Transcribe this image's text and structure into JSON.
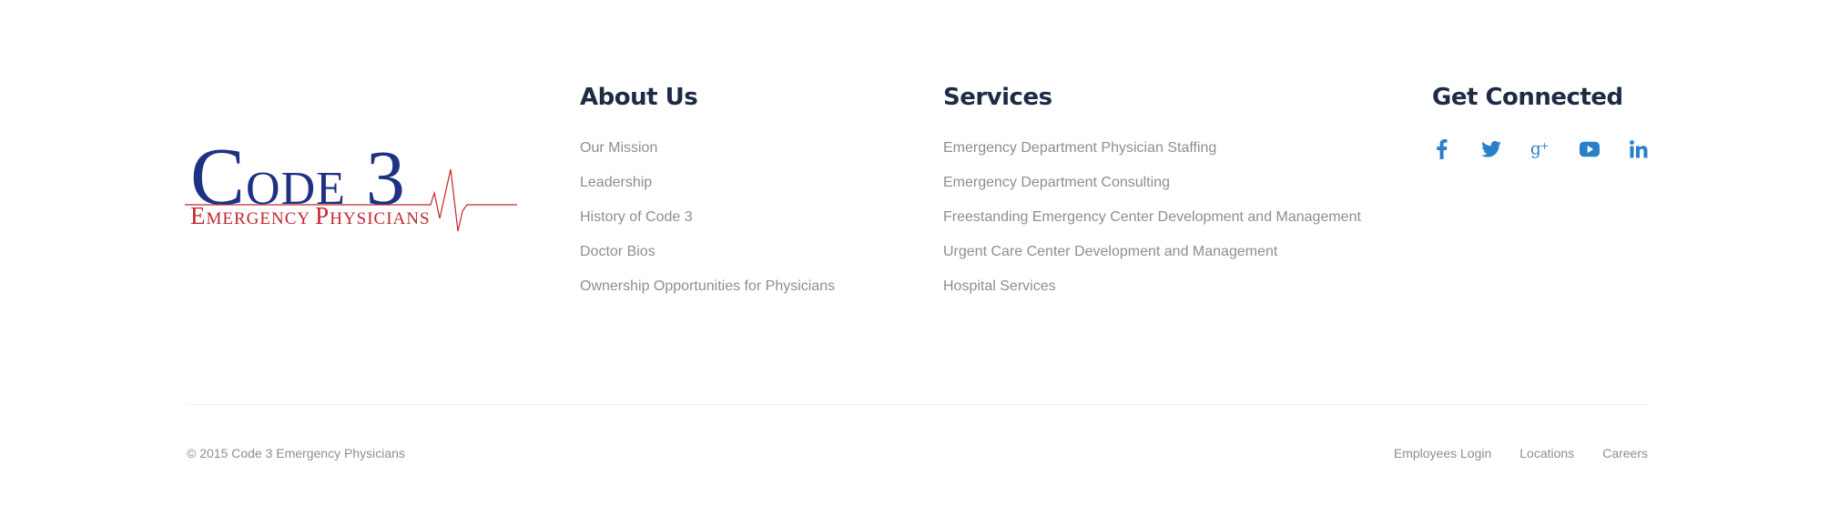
{
  "logo": {
    "text_main": "Code 3",
    "text_sub": "Emergency Physicians",
    "colors": {
      "main": "#1d3283",
      "sub": "#c1272d"
    }
  },
  "about": {
    "heading": "About Us",
    "links": [
      "Our Mission",
      "Leadership",
      "History of Code 3",
      "Doctor Bios",
      "Ownership Opportunities for Physicians"
    ]
  },
  "services": {
    "heading": "Services",
    "links": [
      "Emergency Department Physician Staffing",
      "Emergency Department Consulting",
      "Freestanding Emergency Center Development and Management",
      "Urgent Care Center Development and Management",
      "Hospital Services"
    ]
  },
  "connect": {
    "heading": "Get Connected",
    "icons": [
      "facebook-icon",
      "twitter-icon",
      "google-plus-icon",
      "youtube-icon",
      "linkedin-icon"
    ],
    "icon_color": "#2a7fc9"
  },
  "footer": {
    "copyright": "© 2015 Code 3 Emergency Physicians",
    "links": [
      "Employees Login",
      "Locations",
      "Careers"
    ]
  }
}
